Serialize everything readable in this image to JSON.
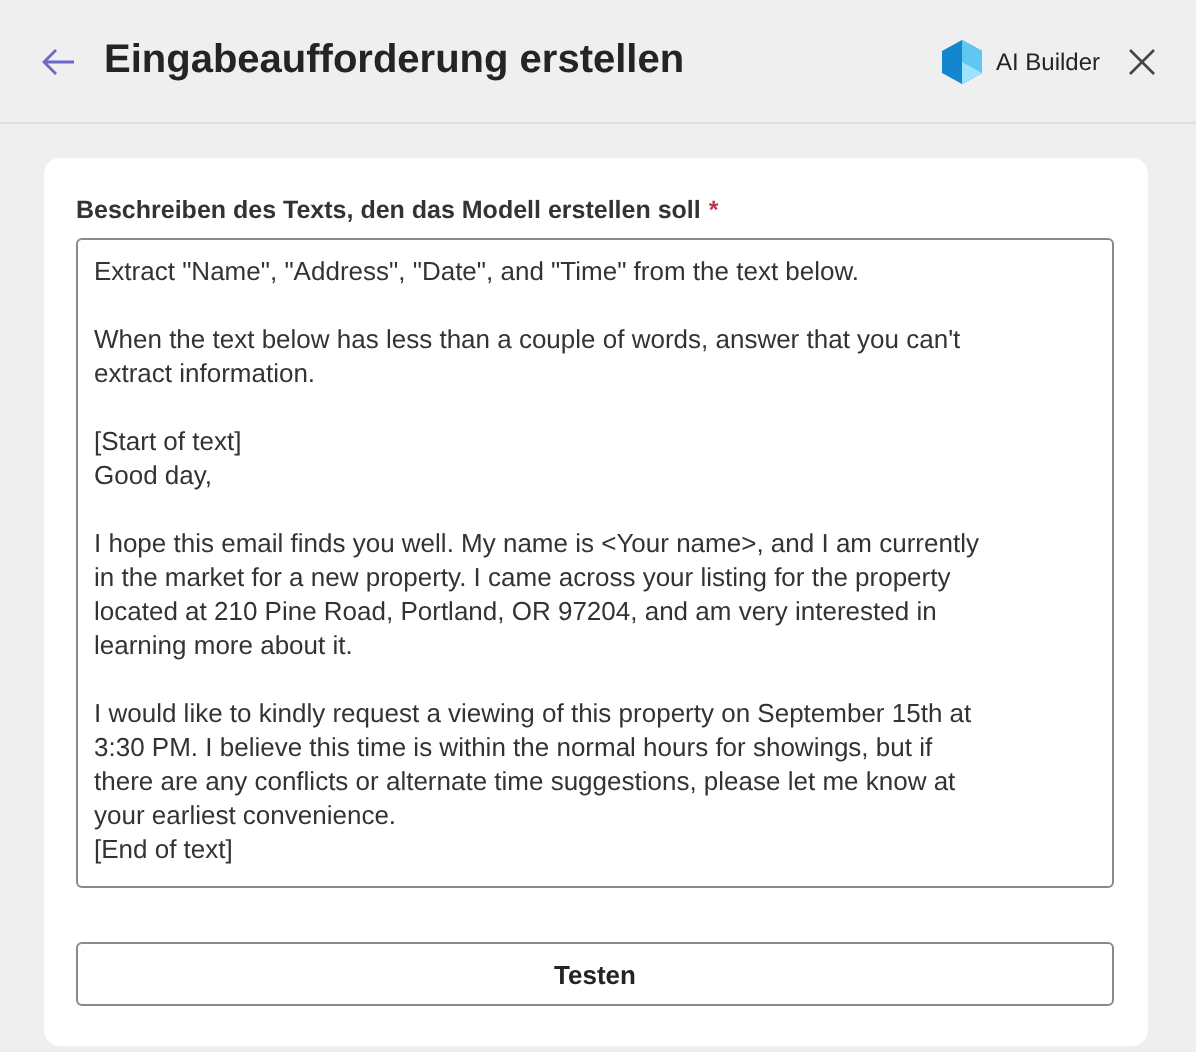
{
  "header": {
    "title": "Eingabeaufforderung erstellen",
    "brand": "AI Builder"
  },
  "form": {
    "label": "Beschreiben des Texts, den das Modell erstellen soll",
    "required_mark": "*",
    "prompt": {
      "value": "Extract \"Name\", \"Address\", \"Date\", and \"Time\" from the text below.\n\nWhen the text below has less than a couple of words, answer that you can't\nextract information.\n\n[Start of text]\nGood day,\n\nI hope this email finds you well. My name is <Your name>, and I am currently\nin the market for a new property. I came across your listing for the property\nlocated at 210 Pine Road, Portland, OR 97204, and am very interested in\nlearning more about it.\n\nI would like to kindly request a viewing of this property on September 15th at\n3:30 PM. I believe this time is within the normal hours for showings, but if\nthere are any conflicts or alternate time suggestions, please let me know at\nyour earliest convenience.\n[End of text]"
    },
    "button": "Testen"
  }
}
